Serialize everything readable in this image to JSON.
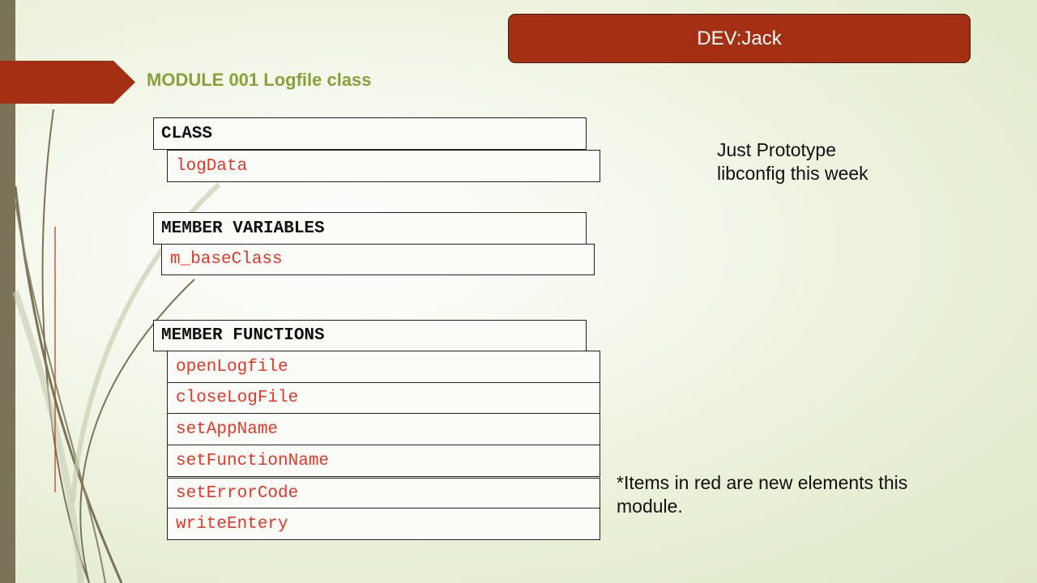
{
  "header": {
    "dev_label": "DEV:Jack"
  },
  "title": "MODULE 001 Logfile class",
  "class_section": {
    "header": "CLASS",
    "name": "logData"
  },
  "member_variables": {
    "header": "MEMBER VARIABLES",
    "items": [
      "m_baseClass"
    ]
  },
  "member_functions": {
    "header": "MEMBER FUNCTIONS",
    "items": [
      "openLogfile",
      "closeLogFile",
      "setAppName",
      "setFunctionName",
      "setErrorCode",
      "writeEntery"
    ]
  },
  "notes": {
    "prototype_line1": "Just Prototype",
    "prototype_line2": "libconfig this week",
    "legend_line1": "*Items in red are new elements this",
    "legend_line2": "module."
  },
  "colors": {
    "accent": "#a52f12",
    "title_green": "#88a13a",
    "new_item_red": "#e0372a",
    "side_bar": "#7a7358"
  }
}
